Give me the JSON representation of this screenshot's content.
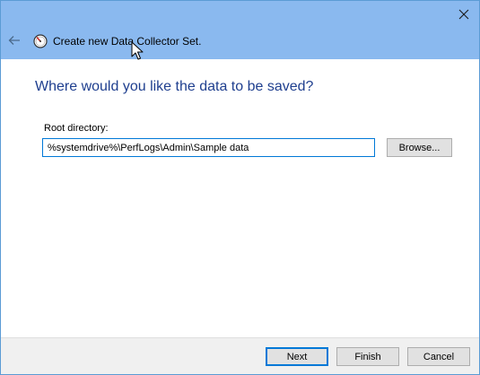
{
  "window": {
    "title": "Create new Data Collector Set.",
    "close_icon": "close-icon",
    "back_icon": "back-arrow-icon",
    "app_icon": "performance-monitor-icon",
    "titlebar_color": "#8ab9ef"
  },
  "content": {
    "heading": "Where would you like the data to be saved?",
    "root_directory_label": "Root directory:",
    "root_directory_value": "%systemdrive%\\PerfLogs\\Admin\\Sample data",
    "browse_label": "Browse..."
  },
  "footer": {
    "next_label": "Next",
    "finish_label": "Finish",
    "cancel_label": "Cancel"
  }
}
